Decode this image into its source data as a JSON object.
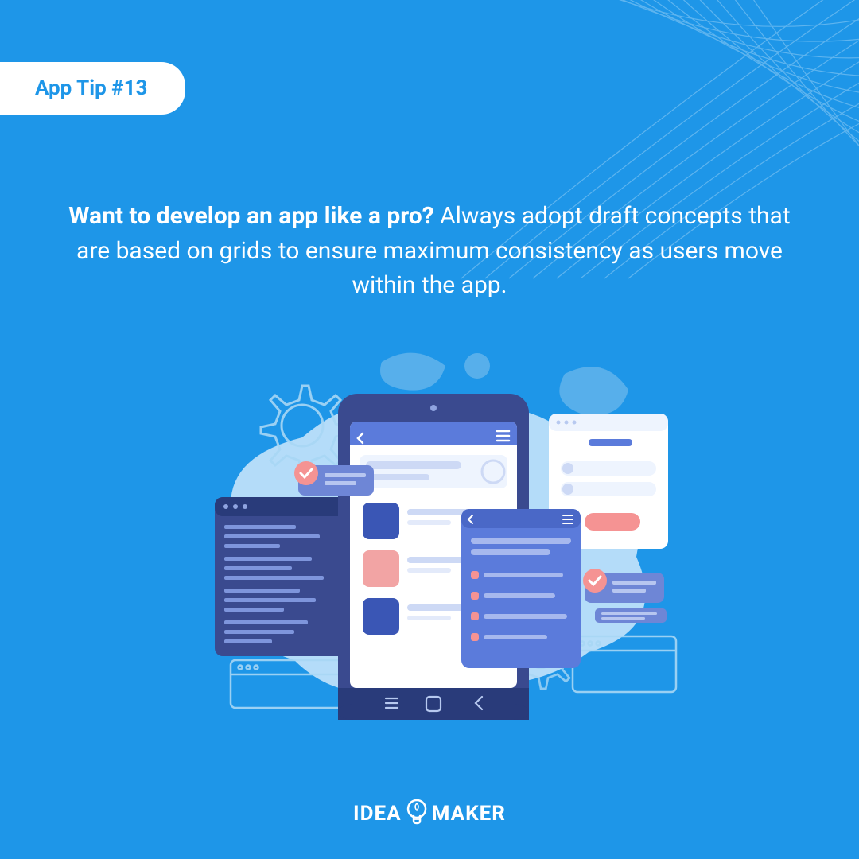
{
  "badge": {
    "label": "App Tip #13"
  },
  "headline": {
    "bold": "Want to develop an app like a pro?",
    "rest": " Always adopt draft concepts that are based on grids to ensure maximum consistency as users move within the app."
  },
  "logo": {
    "left": "IDEA",
    "right": "MAKER"
  },
  "colors": {
    "background": "#1E96E8",
    "accent": "#ffffff",
    "phoneFrame": "#3A4A8F",
    "phoneDark": "#293B7A",
    "cardBlue": "#5B7BDB",
    "cardPink": "#F2A4A4",
    "cardDeep": "#3A56B5",
    "pinkBtn": "#F59393",
    "blobLight": "#CFE9FB",
    "blobMid": "#6FB9EC"
  }
}
